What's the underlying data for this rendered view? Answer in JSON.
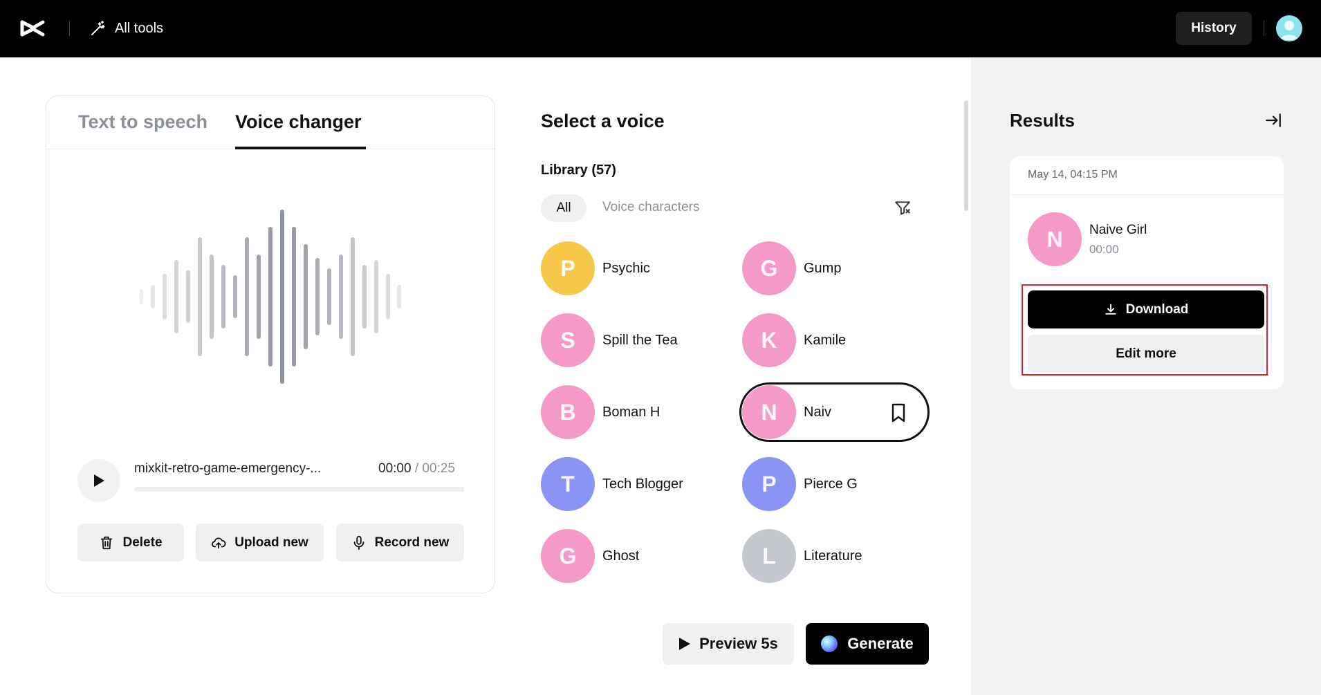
{
  "topbar": {
    "logo_icon": "capcut-logo-icon",
    "all_tools_label": "All tools",
    "history_label": "History"
  },
  "left_panel": {
    "tabs": [
      {
        "label": "Text to speech",
        "active": false
      },
      {
        "label": "Voice changer",
        "active": true
      }
    ],
    "player": {
      "filename": "mixkit-retro-game-emergency-...",
      "current_time": "00:00",
      "total_time": "/ 00:25",
      "progress": 0
    },
    "actions": {
      "delete_label": "Delete",
      "upload_label": "Upload new",
      "record_label": "Record new"
    }
  },
  "voice_panel": {
    "title": "Select a voice",
    "library_label": "Library (57)",
    "filters": {
      "all_label": "All",
      "voice_characters_label": "Voice characters"
    },
    "voices": [
      {
        "name": "Psychic",
        "color": "#f6c84a",
        "initial": "P"
      },
      {
        "name": "Gump",
        "color": "#f59ac8",
        "initial": "G"
      },
      {
        "name": "Spill the Tea",
        "color": "#f59ac8",
        "initial": "S"
      },
      {
        "name": "Kamile",
        "color": "#f59ac8",
        "initial": "K"
      },
      {
        "name": "Boman H",
        "color": "#f59ac8",
        "initial": "B"
      },
      {
        "name": "Naiv",
        "color": "#f59ac8",
        "initial": "N",
        "selected": true
      },
      {
        "name": "Tech Blogger",
        "color": "#8a94f5",
        "initial": "T"
      },
      {
        "name": "Pierce G",
        "color": "#8a94f5",
        "initial": "P"
      },
      {
        "name": "Ghost",
        "color": "#f59ac8",
        "initial": "G"
      },
      {
        "name": "Literature",
        "color": "#d9dcdf",
        "initial": "L"
      }
    ],
    "preview_label": "Preview 5s",
    "generate_label": "Generate"
  },
  "results": {
    "title": "Results",
    "item": {
      "date": "May 14, 04:15 PM",
      "voice_name": "Naive Girl",
      "voice_initial": "N",
      "time": "00:00",
      "download_label": "Download",
      "edit_more_label": "Edit more"
    }
  },
  "colors": {
    "topbar_bg": "#000000",
    "results_bg": "#f0f2f4",
    "highlight": "#e0232b",
    "button_light": "#eef0f2"
  }
}
